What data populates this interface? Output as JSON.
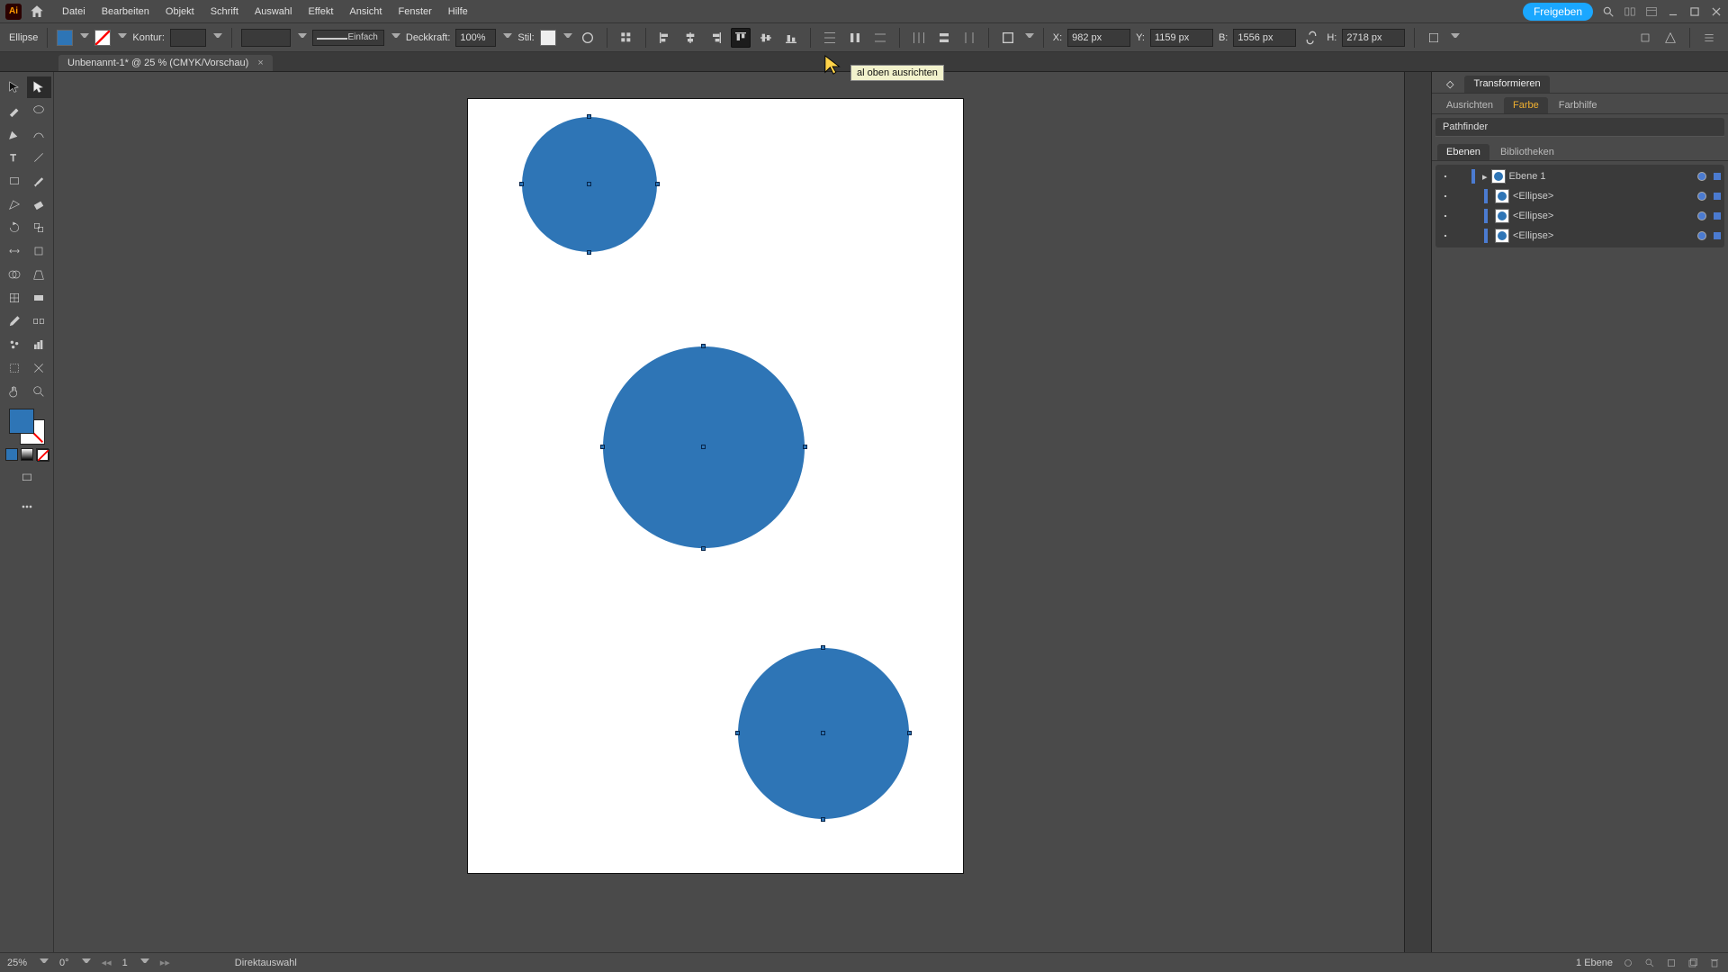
{
  "app": {
    "logo_text": "Ai"
  },
  "menu": {
    "items": [
      "Datei",
      "Bearbeiten",
      "Objekt",
      "Schrift",
      "Auswahl",
      "Effekt",
      "Ansicht",
      "Fenster",
      "Hilfe"
    ],
    "share": "Freigeben"
  },
  "control": {
    "active_tool_label": "Ellipse",
    "stroke_label": "Kontur:",
    "stroke_picker_label": "Einfach",
    "opacity_label": "Deckkraft:",
    "opacity_value": "100%",
    "style_label": "Stil:",
    "x_label": "X:",
    "x_value": "982 px",
    "y_label": "Y:",
    "y_value": "1159 px",
    "w_label": "B:",
    "w_value": "1556 px",
    "h_label": "H:",
    "h_value": "2718 px",
    "tooltip": "al oben ausrichten"
  },
  "colors": {
    "fill": "#2e75b6",
    "accent": "#1aa7ff"
  },
  "doc": {
    "tab_title": "Unbenannt-1* @ 25 % (CMYK/Vorschau)"
  },
  "right": {
    "tab_transform": "Transformieren",
    "tab_align": "Ausrichten",
    "tab_color": "Farbe",
    "tab_guide": "Farbhilfe",
    "pathfinder_title": "Pathfinder",
    "tab_layers": "Ebenen",
    "tab_libs": "Bibliotheken",
    "layer_name": "Ebene 1",
    "ellipse_label": "<Ellipse>"
  },
  "status": {
    "zoom": "25%",
    "rotation": "0°",
    "artboard": "1",
    "mode": "Direktauswahl",
    "layer_count": "1 Ebene"
  }
}
